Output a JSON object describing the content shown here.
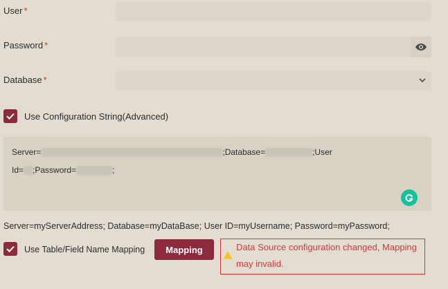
{
  "form": {
    "user_label": "User",
    "password_label": "Password",
    "database_label": "Database",
    "required_mark": "*",
    "user_value": "",
    "password_value": "",
    "database_value": ""
  },
  "config": {
    "use_config_string_label": "Use Configuration String(Advanced)",
    "use_config_string_checked": true,
    "conn_part1": "Server=",
    "conn_part2": ";Database=",
    "conn_part3": ";User",
    "conn_part4": "Id=",
    "conn_part5": ";Password=",
    "conn_part6": ";",
    "example": "Server=myServerAddress; Database=myDataBase; User ID=myUsername; Password=myPassword;"
  },
  "mapping": {
    "use_mapping_label": "Use Table/Field Name Mapping",
    "use_mapping_checked": true,
    "button_label": "Mapping",
    "warning_line1": "Data Source configuration changed, Mapping",
    "warning_line2": "may invalid."
  },
  "icons": {
    "eye": "eye-icon",
    "chevron": "chevron-down-icon",
    "check": "check-icon",
    "grammarly": "grammarly-icon",
    "warning": "warning-icon"
  },
  "colors": {
    "accent": "#8d2a3e",
    "warning": "#e0343a",
    "grammarly": "#15c39a"
  }
}
